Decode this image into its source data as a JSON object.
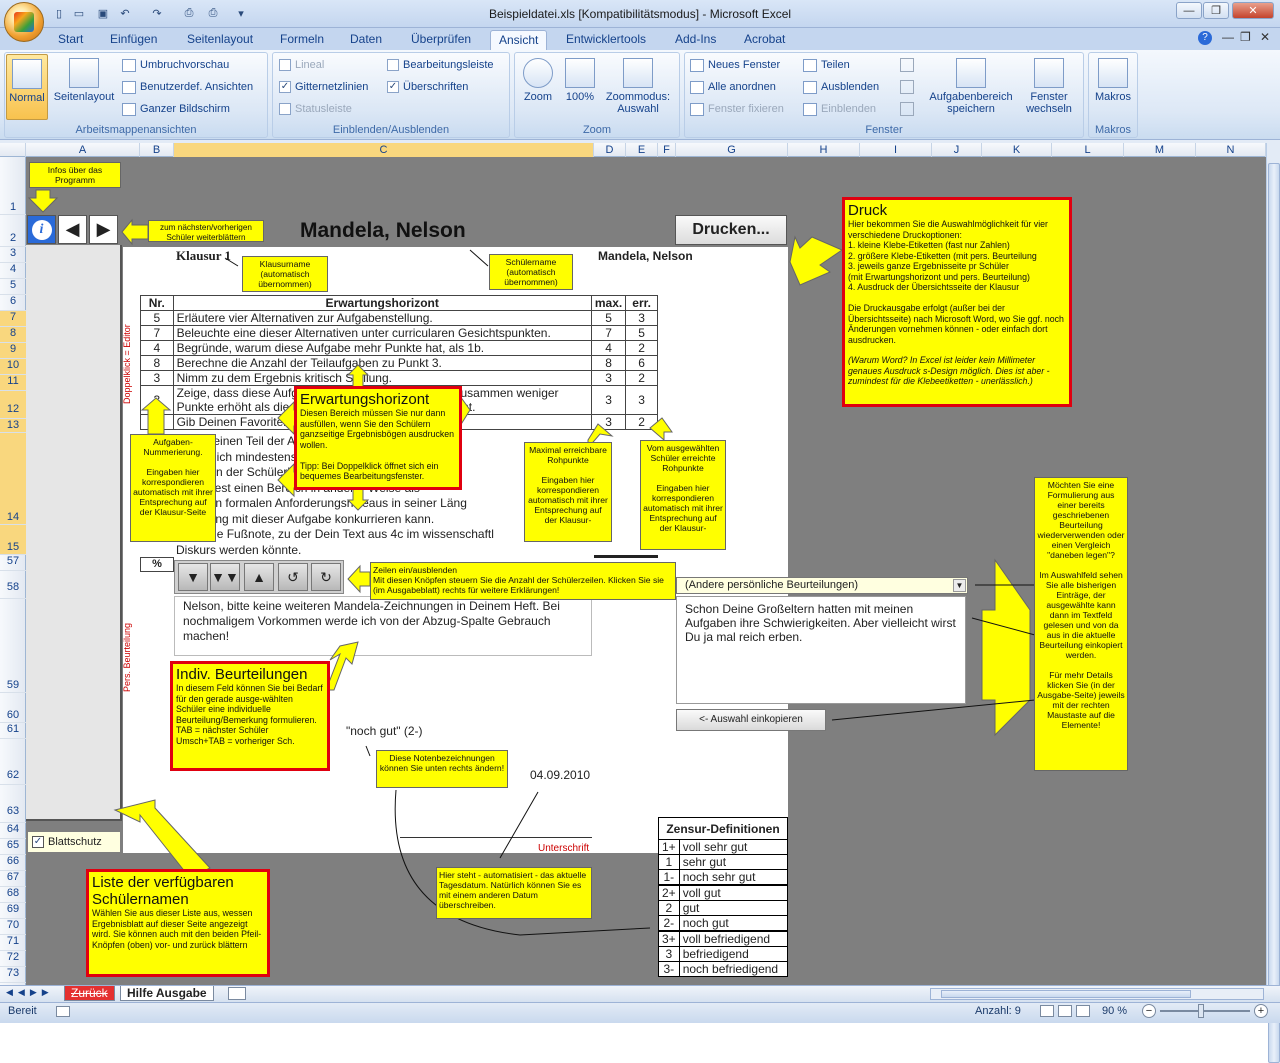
{
  "window": {
    "title": "Beispieldatei.xls [Kompatibilitätsmodus] - Microsoft Excel"
  },
  "ribbon_tabs": [
    "Start",
    "Einfügen",
    "Seitenlayout",
    "Formeln",
    "Daten",
    "Überprüfen",
    "Ansicht",
    "Entwicklertools",
    "Add-Ins",
    "Acrobat"
  ],
  "active_tab": "Ansicht",
  "groups": {
    "arbeitsmappenansichten": {
      "label": "Arbeitsmappenansichten",
      "normal": "Normal",
      "seitenlayout": "Seitenlayout",
      "umbruch": "Umbruchvorschau",
      "benutzer": "Benutzerdef. Ansichten",
      "ganzer": "Ganzer Bildschirm"
    },
    "einblenden": {
      "label": "Einblenden/Ausblenden",
      "lineal": "Lineal",
      "gitternetz": "Gitternetzlinien",
      "statusleiste": "Statusleiste",
      "bearbeitung": "Bearbeitungsleiste",
      "ueberschriften": "Überschriften"
    },
    "zoom": {
      "label": "Zoom",
      "zoom": "Zoom",
      "hundert": "100%",
      "auswahl": "Zoommodus: Auswahl"
    },
    "fenster": {
      "label": "Fenster",
      "neues": "Neues Fenster",
      "anordnen": "Alle anordnen",
      "fixieren": "Fenster fixieren",
      "teilen": "Teilen",
      "ausblenden": "Ausblenden",
      "einblenden": "Einblenden",
      "aufgaben": "Aufgabenbereich speichern",
      "wechseln": "Fenster wechseln"
    },
    "makros": {
      "label": "Makros",
      "makros": "Makros"
    }
  },
  "columns": [
    "A",
    "B",
    "C",
    "D",
    "E",
    "F",
    "G",
    "H",
    "I",
    "J",
    "K",
    "L",
    "M",
    "N"
  ],
  "rows": [
    "1",
    "2",
    "3",
    "4",
    "5",
    "6",
    "7",
    "8",
    "9",
    "10",
    "11",
    "12",
    "13",
    "14",
    "15",
    "57",
    "58",
    "59",
    "60",
    "61",
    "62",
    "63",
    "64",
    "65",
    "66",
    "67",
    "68",
    "69",
    "70",
    "71",
    "72",
    "73"
  ],
  "sheet": {
    "student_name": "Mandela, Nelson",
    "student_name_small": "Mandela, Nelson",
    "klausur": "Klausur 1",
    "print_button": "Drucken...",
    "table_headers": {
      "nr": "Nr.",
      "eh": "Erwartungshorizont",
      "max": "max.",
      "err": "err."
    },
    "tasks": [
      {
        "nr": "5",
        "text": "Erläutere vier Alternativen zur Aufgabenstellung.",
        "max": "5",
        "err": "3"
      },
      {
        "nr": "7",
        "text": "Beleuchte eine dieser Alternativen unter curricularen Gesichtspunkten.",
        "max": "7",
        "err": "5"
      },
      {
        "nr": "4",
        "text": "Begründe, warum diese Aufgabe mehr Punkte hat, als 1b.",
        "max": "4",
        "err": "2"
      },
      {
        "nr": "8",
        "text": "Berechne die Anzahl der Teilaufgaben zu Punkt 3.",
        "max": "8",
        "err": "6"
      },
      {
        "nr": "3",
        "text": "Nimm zu dem Ergebnis kritisch Stellung.",
        "max": "3",
        "err": "2"
      },
      {
        "nr": "3",
        "text": "Zeige, dass diese Aufgabe in der Summe ihrer Teile zusammen weniger Punkte erhöht als die Summe aller Aufgaben insgesamt.",
        "max": "3",
        "err": "3"
      },
      {
        "nr": "3",
        "text": "Gib Deinen Favoriten unter den Teilaufgaben an.",
        "max": "3",
        "err": "2"
      }
    ],
    "long_text": [
      "Wähle einen Teil der Aufgaben mit 3 Seiten",
      "schließlich mindestens (aber zweiseite) als",
      "erdem in der Schülerleistung einem gesch",
      "zumindest einen Bereich in anderer Weise als",
      "chenden formalen Anforderungsniveaus in seiner Läng",
      "vurbelung mit dieser Aufgabe konkurrieren kann.",
      "Kläre die Fußnote, zu der Dein Text aus 4c im wissenschaftl"
    ],
    "diskurs": "Diskurs werden könnte.",
    "percent": "%",
    "beurteilung_text": "Nelson, bitte keine weiteren Mandela-Zeichnungen in Deinem Heft. Bei nochmaligem Vorkommen werde ich von der Abzug-Spalte Gebrauch machen!",
    "grade": "\"noch gut\" (2-)",
    "date": "04.09.2010",
    "unterschrift": "Unterschrift",
    "side_editor": "Doppelklick = Editor",
    "side_pers": "Pers. Beurteilung",
    "dropdown_value": "(Andere persönliche Beurteilungen)",
    "textbox_value": "Schon Deine Großeltern hatten mit meinen Aufgaben ihre Schwierigkeiten. Aber vielleicht wirst Du ja mal reich erben.",
    "copy_button": "<- Auswahl einkopieren",
    "blattschutz": "Blattschutz"
  },
  "zensur": {
    "title": "Zensur-Definitionen",
    "items": [
      [
        "1+",
        "voll sehr gut"
      ],
      [
        "1",
        "sehr gut"
      ],
      [
        "1-",
        "noch sehr gut"
      ],
      [
        "2+",
        "voll gut"
      ],
      [
        "2",
        "gut"
      ],
      [
        "2-",
        "noch gut"
      ],
      [
        "3+",
        "voll befriedigend"
      ],
      [
        "3",
        "befriedigend"
      ],
      [
        "3-",
        "noch befriedigend"
      ]
    ]
  },
  "callouts": {
    "infos": "Infos über das Programm",
    "blaettern": "zum nächsten/vorherigen Schüler weiterblättern",
    "klausurname": "Klausurname (automatisch übernommen)",
    "schuelername": "Schülername (automatisch übernommen)",
    "nummerierung": "Aufgaben-Nummerierung.\n\nEingaben hier korrespondieren automatisch mit ihrer Entsprechung auf der Klausur-Seite",
    "maximal": "Maximal erreichbare Rohpunkte\n\nEingaben hier korrespondieren automatisch mit ihrer Entsprechung auf der Klausur-",
    "vom_schueler": "Vom ausgewählten Schüler erreichte Rohpunkte\n\nEingaben hier korrespondieren automatisch mit ihrer Entsprechung auf der Klausur-",
    "zeilen": "Zeilen ein/ausblenden\nMit diesen Knöpfen steuern Sie die Anzahl der Schülerzeilen. Klicken Sie sie (im Ausgabeblatt) rechts für weitere Erklärungen!",
    "noten": "Diese Notenbezeichnungen können Sie unten rechts ändern!",
    "datum": "Hier steht - automatisiert - das aktuelle Tagesdatum. Natürlich können Sie es mit einem anderen Datum überschreiben.",
    "formulierung": "Möchten Sie eine Formulierung aus einer bereits geschriebenen Beurteilung wiederverwenden oder einen Vergleich \"daneben legen\"?\n\nIm Auswahlfeld sehen Sie alle bisherigen Einträge, der ausgewählte kann dann im Textfeld gelesen und von da aus in die aktuelle Beurteilung einkopiert werden.\n\nFür mehr Details klicken Sie (in der Ausgabe-Seite) jeweils mit der rechten Maustaste auf die Elemente!"
  },
  "red_callouts": {
    "druck_title": "Druck",
    "druck_body": "Hier bekommen Sie die Auswahlmöglichkeit für vier verschiedene Druckoptionen:\n1. kleine Klebe-Etiketten (fast nur Zahlen)\n2. größere Klebe-Etiketten (mit pers. Beurteilung\n3. jeweils ganze Ergebnisseite pr Schüler\n     (mit Erwartungshorizont und pers. Beurteilung)\n4. Ausdruck der Übersichtsseite der Klausur\n\nDie Druckausgabe erfolgt (außer bei der Übersichtsseite) nach Microsoft Word, wo Sie ggf. noch Änderungen vornehmen können - oder einfach dort ausdrucken.",
    "druck_note": "(Warum Word? In Excel ist leider kein Millimeter genaues Ausdruck s-Design möglich. Dies ist aber - zumindest für die Klebeetiketten - unerlässlich.)",
    "eh_title": "Erwartungshorizont",
    "eh_body": "Diesen Bereich müssen Sie nur dann ausfüllen, wenn Sie den Schülern ganzseitige Ergebnisbögen ausdrucken wollen.\n\nTipp: Bei Doppelklick öffnet sich ein bequemes Bearbeitungsfenster.",
    "indiv_title": "Indiv. Beurteilungen",
    "indiv_body": "In diesem Feld können Sie bei Bedarf für den gerade ausge-wählten Schüler eine individuelle Beurteilung/Bemerkung formulieren.\n   TAB            = nächster Schüler\n   Umsch+TAB = vorheriger Sch.",
    "liste_title": "Liste der verfügbaren Schülernamen",
    "liste_body": "Wählen Sie aus dieser Liste aus, wessen Ergebnisblatt auf dieser Seite angezeigt wird. Sie können auch mit den beiden Pfeil-Knöpfen (oben) vor- und zurück blättern"
  },
  "sheet_tabs": [
    "Zurück",
    "Hilfe Ausgabe"
  ],
  "status": {
    "ready": "Bereit",
    "count": "Anzahl: 9",
    "zoom": "90 %"
  },
  "colors": {
    "callout_yellow": "#ffff00",
    "callout_red": "#e0000f",
    "sheet_gray": "#7f7f7f"
  }
}
